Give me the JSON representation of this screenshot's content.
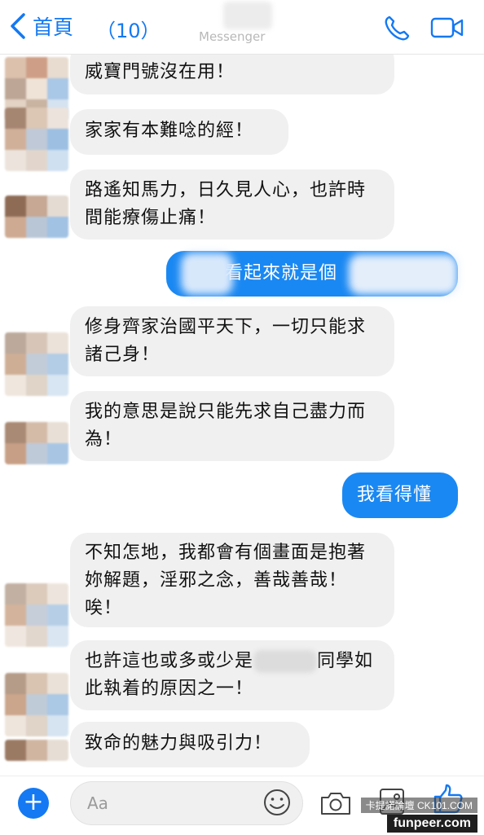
{
  "header": {
    "back_label": "首頁",
    "unread_count": "（10）",
    "subtitle": "Messenger"
  },
  "messages": [
    {
      "from": "them",
      "text": "威寶門號沒在用！"
    },
    {
      "from": "them",
      "text": "家家有本難唸的經！"
    },
    {
      "from": "them",
      "text": "路遙知馬力，日久見人心，也許時間能療傷止痛！"
    },
    {
      "from": "me",
      "text": "看起來就是個"
    },
    {
      "from": "them",
      "text": "修身齊家治國平天下，一切只能求諸己身！"
    },
    {
      "from": "them",
      "text": "我的意思是說只能先求自己盡力而為！"
    },
    {
      "from": "me",
      "text": "我看得懂"
    },
    {
      "from": "them",
      "text": "不知怎地，我都會有個畫面是抱著妳解題，淫邪之念，善哉善哉！唉！"
    },
    {
      "from": "them",
      "text_before": "也許這也或多或少是",
      "text_after": "同學如此執着的原因之一！"
    },
    {
      "from": "them",
      "text": "致命的魅力與吸引力！"
    }
  ],
  "composer": {
    "placeholder": "Aa"
  },
  "watermark": {
    "line1": "卡提諾論壇 CK101.COM",
    "line2": "funpeer.com"
  },
  "colors": {
    "accent": "#1479f2",
    "outgoing_bubble": "#1a88f2",
    "incoming_bubble": "#f1f0f0"
  },
  "icons": [
    "chevron-left-icon",
    "phone-icon",
    "video-camera-icon",
    "plus-icon",
    "emoji-icon",
    "camera-icon",
    "gallery-icon",
    "thumbs-up-icon"
  ]
}
